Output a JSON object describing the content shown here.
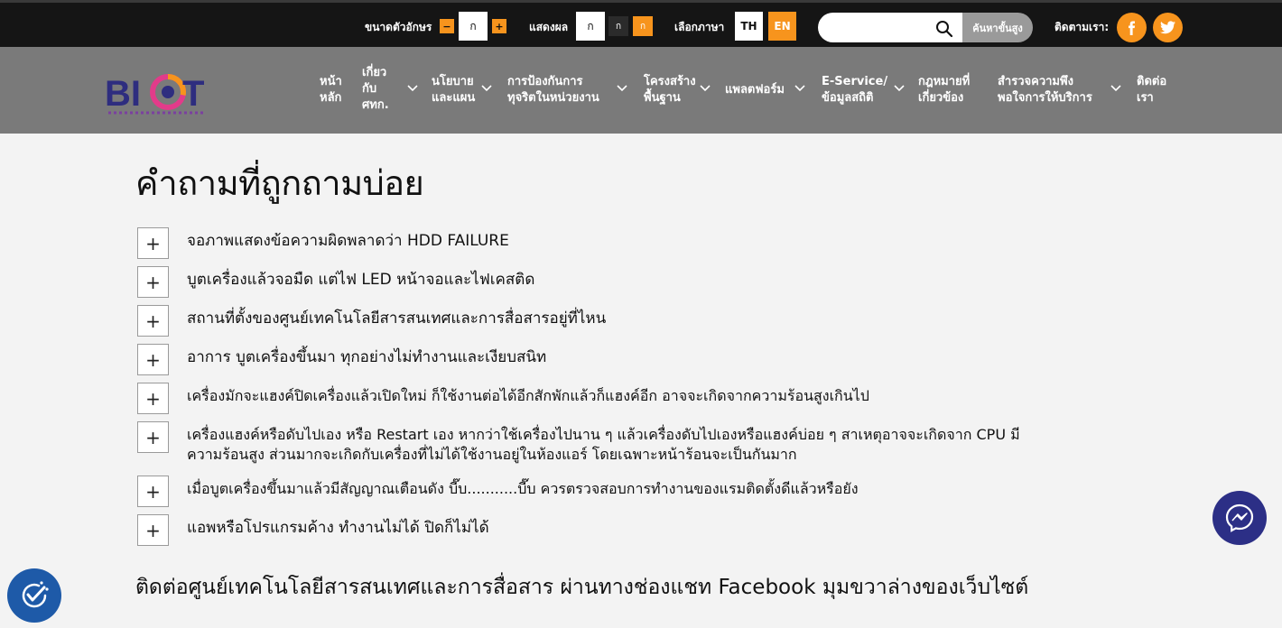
{
  "topbar": {
    "font_size_label": "ขนาดตัวอักษร",
    "font_minus": "−",
    "font_current": "ก",
    "font_plus": "+",
    "display_label": "แสดงผล",
    "display_normal": "ก",
    "display_dark": "ก",
    "display_contrast": "ก",
    "language_label": "เลือกภาษา",
    "lang_th": "TH",
    "lang_en": "EN",
    "search_placeholder": "",
    "advanced_search": "ค้นหาขั้นสูง",
    "follow_label": "ติดตามเรา:",
    "facebook_icon": "facebook-icon",
    "twitter_icon": "twitter-icon"
  },
  "brand": {
    "logo_text": "BICT"
  },
  "nav": {
    "items": [
      {
        "label": "หน้า\nหลัก"
      },
      {
        "label": "เกี่ยว\nกับ\nศทก."
      },
      {
        "label": "นโยบาย\nและแผน"
      },
      {
        "label": "การป้องกันการ\nทุจริตในหน่วยงาน"
      },
      {
        "label": "โครงสร้าง\nพื้นฐาน"
      },
      {
        "label": "แพลตฟอร์ม"
      },
      {
        "label": "E-Service/\nข้อมูลสถิติ"
      },
      {
        "label": "กฎหมายที่\nเกี่ยวข้อง"
      },
      {
        "label": "สำรวจความพึง\nพอใจการให้บริการ"
      },
      {
        "label": "ติดต่อ\nเรา"
      }
    ]
  },
  "page": {
    "title": "คำถามที่ถูกถามบ่อย",
    "expand_symbol": "+",
    "faqs": [
      "จอภาพแสดงข้อความผิดพลาดว่า HDD FAILURE",
      "บูตเครื่องแล้วจอมืด แต่ไฟ LED หน้าจอและไฟเคสติด",
      "สถานที่ตั้งของศูนย์เทคโนโลยีสารสนเทศและการสื่อสารอยู่ที่ไหน",
      "อาการ บูตเครื่องขึ้นมา ทุกอย่างไม่ทำงานและเงียบสนิท",
      "เครื่องมักจะแฮงค์ปิดเครื่องแล้วเปิดใหม่ ก็ใช้งานต่อได้อีกสักพักแล้วก็แฮงค์อีก อาจจะเกิดจากความร้อนสูงเกินไป",
      "เครื่องแฮงค์หรือดับไปเอง หรือ Restart เอง หากว่าใช้เครื่องไปนาน ๆ แล้วเครื่องดับไปเองหรือแฮงค์บ่อย ๆ สาเหตุอาจจะเกิดจาก CPU มีความร้อนสูง ส่วนมากจะเกิดกับเครื่องที่ไม่ได้ใช้งานอยู่ในห้องแอร์ โดยเฉพาะหน้าร้อนจะเป็นกันมาก",
      "เมื่อบูตเครื่องขึ้นมาแล้วมีสัญญาณเตือนดัง บี๊บ...........บี๊บ ควรตรวจสอบการทำงานของแรมติดตั้งดีแล้วหรือยัง",
      "แอพหรือโปรแกรมค้าง ทำงานไม่ได้ ปิดก็ไม่ได้"
    ],
    "contact_note": "ติดต่อศูนย์เทคโนโลยีสารสนเทศและการสื่อสาร ผ่านทางช่องแชท Facebook มุมขวาล่างของเว็บไซต์"
  },
  "colors": {
    "accent": "#f7941d",
    "topbar_bg": "#151515",
    "nav_bg": "#7a7a7a",
    "page_bg": "#f3f3f3"
  }
}
